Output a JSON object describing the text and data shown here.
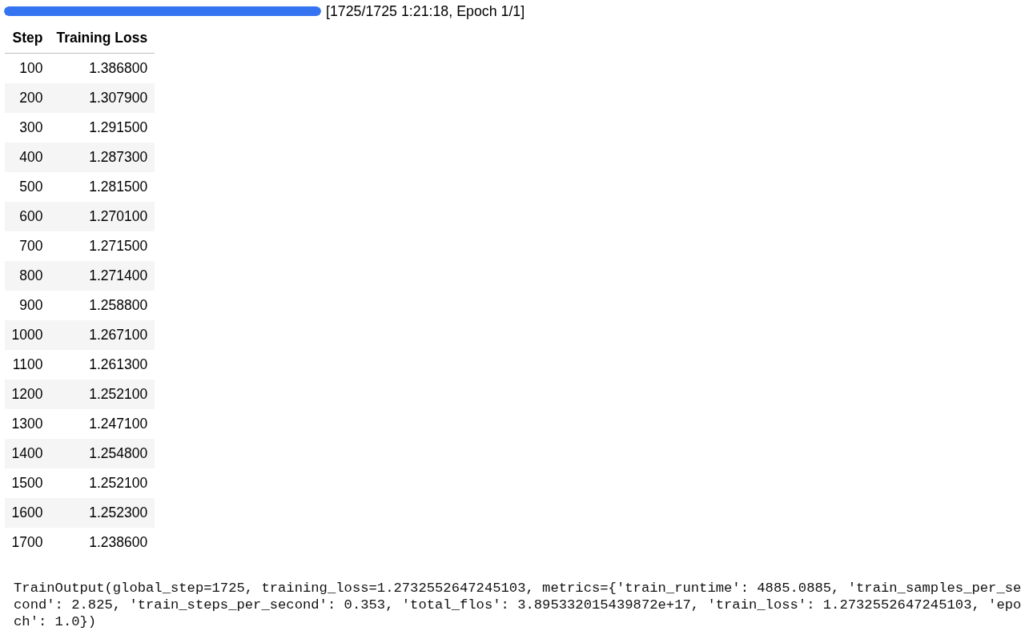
{
  "progress": {
    "level": 1,
    "label": "[1725/1725 1:21:18, Epoch 1/1]"
  },
  "table": {
    "columns": [
      "Step",
      "Training Loss"
    ],
    "rows": [
      [
        "100",
        "1.386800"
      ],
      [
        "200",
        "1.307900"
      ],
      [
        "300",
        "1.291500"
      ],
      [
        "400",
        "1.287300"
      ],
      [
        "500",
        "1.281500"
      ],
      [
        "600",
        "1.270100"
      ],
      [
        "700",
        "1.271500"
      ],
      [
        "800",
        "1.271400"
      ],
      [
        "900",
        "1.258800"
      ],
      [
        "1000",
        "1.267100"
      ],
      [
        "1100",
        "1.261300"
      ],
      [
        "1200",
        "1.252100"
      ],
      [
        "1300",
        "1.247100"
      ],
      [
        "1400",
        "1.254800"
      ],
      [
        "1500",
        "1.252100"
      ],
      [
        "1600",
        "1.252300"
      ],
      [
        "1700",
        "1.238600"
      ]
    ]
  },
  "output": "TrainOutput(global_step=1725, training_loss=1.2732552647245103, metrics={'train_runtime': 4885.0885, 'train_samples_per_second': 2.825, 'train_steps_per_second': 0.353, 'total_flos': 3.895332015439872e+17, 'train_loss': 1.2732552647245103, 'epoch': 1.0})"
}
